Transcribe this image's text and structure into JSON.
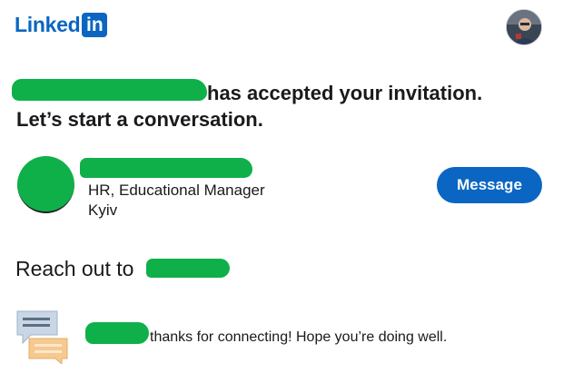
{
  "brand": {
    "logo_word": "Linked",
    "logo_box": "in"
  },
  "headline": {
    "line1": "has accepted your invitation.",
    "line2": "Let’s start a conversation."
  },
  "contact": {
    "title": "HR, Educational Manager",
    "location": "Kyiv"
  },
  "actions": {
    "message_label": "Message"
  },
  "reach": {
    "label": "Reach out to"
  },
  "suggested_message": {
    "text": "thanks for connecting! Hope you’re doing well."
  },
  "colors": {
    "brand": "#0a66c2",
    "redaction": "#0fb04a"
  }
}
